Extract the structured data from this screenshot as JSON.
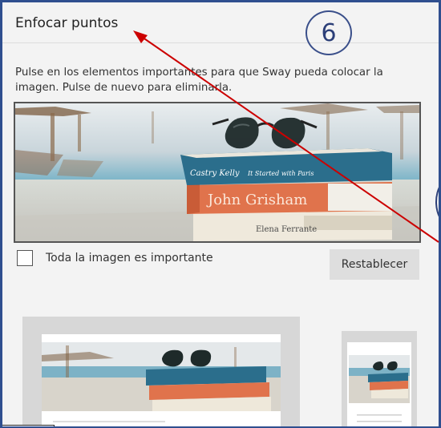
{
  "panel": {
    "title": "Enfocar puntos",
    "step_number": "6",
    "instructions": "Pulse en los elementos importantes para que Sway pueda colocar la imagen. Pulse de nuevo para eliminarla.",
    "checkbox_label": "Toda la imagen es importante",
    "checkbox_checked": false,
    "reset_label": "Restablecer"
  },
  "image": {
    "book1_title": "Castry Kelly",
    "book1_subtitle": "It Started with Paris",
    "book2_title": "John Grisham",
    "book3_title": "Elena Ferrante"
  },
  "colors": {
    "frame_border": "#2f4f8f",
    "annotation_arrow": "#cc0000",
    "book_teal": "#2b6e8c",
    "book_orange": "#e0734c"
  }
}
